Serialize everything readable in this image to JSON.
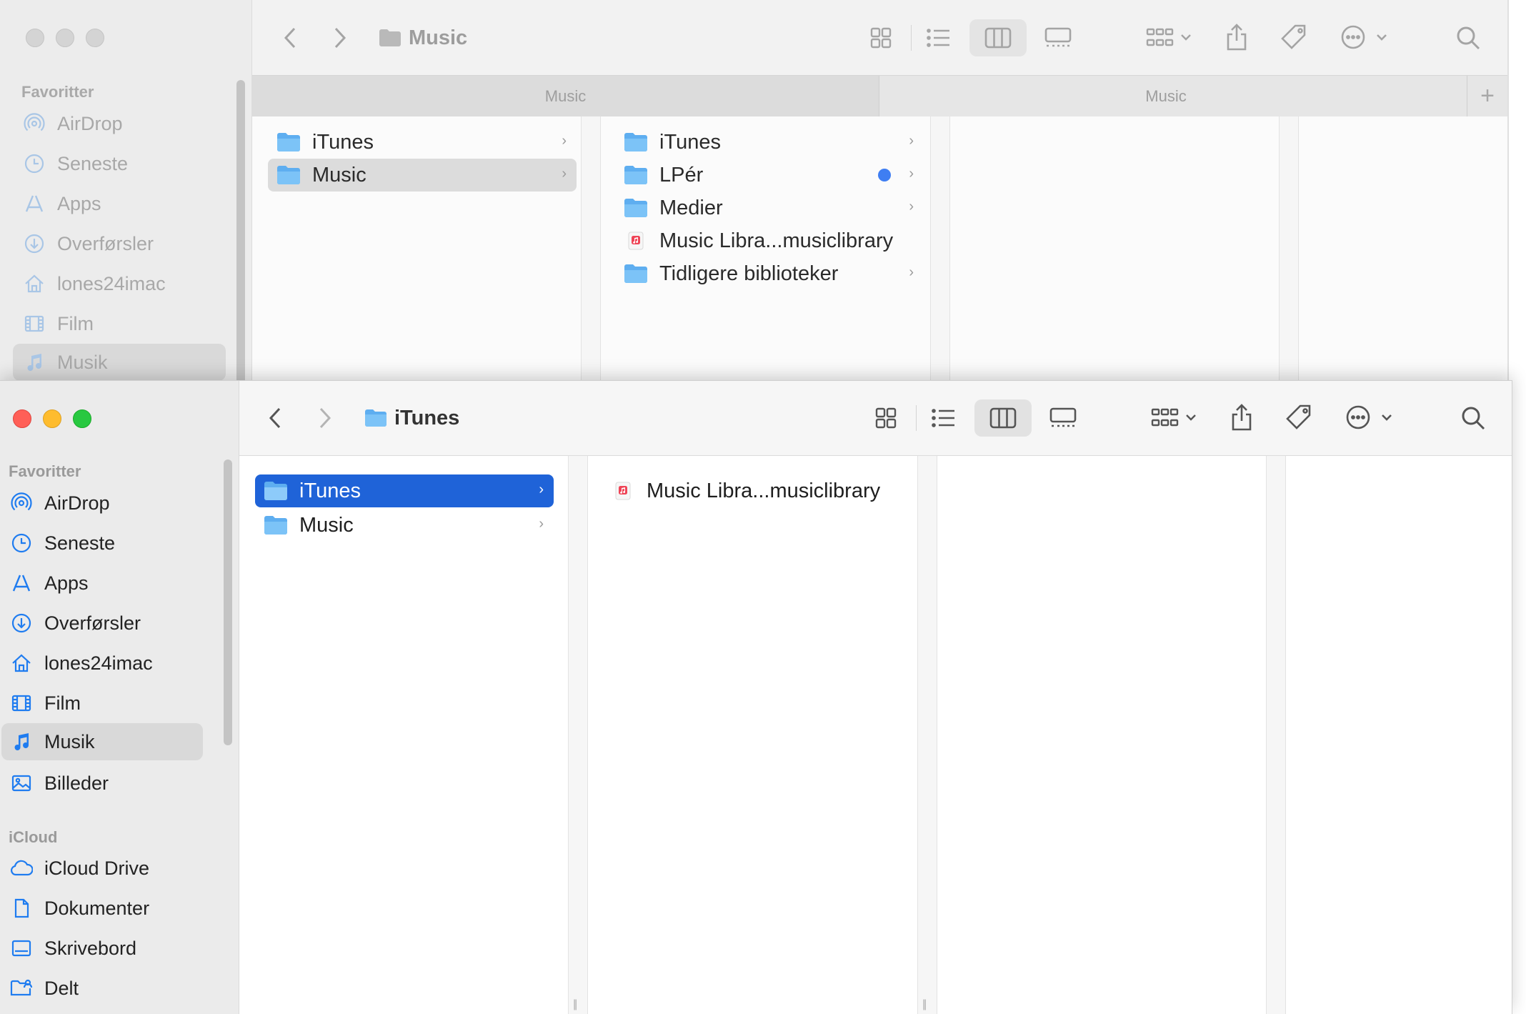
{
  "back_window": {
    "title": "Music",
    "sidebar": {
      "section_favorites": "Favoritter",
      "items": [
        {
          "label": "AirDrop",
          "icon": "airdrop-icon"
        },
        {
          "label": "Seneste",
          "icon": "clock-icon"
        },
        {
          "label": "Apps",
          "icon": "apps-icon"
        },
        {
          "label": "Overførsler",
          "icon": "download-icon"
        },
        {
          "label": "lones24imac",
          "icon": "home-icon"
        },
        {
          "label": "Film",
          "icon": "film-icon"
        },
        {
          "label": "Musik",
          "icon": "music-note-icon",
          "selected": true
        }
      ]
    },
    "tabs": [
      {
        "label": "Music",
        "active": true
      },
      {
        "label": "Music",
        "active": false
      }
    ],
    "column1": [
      {
        "label": "iTunes",
        "type": "folder",
        "selected": false
      },
      {
        "label": "Music",
        "type": "folder",
        "selected": true
      }
    ],
    "column2": [
      {
        "label": "iTunes",
        "type": "folder"
      },
      {
        "label": "LPér",
        "type": "folder",
        "tag_color": "#3f7ef2"
      },
      {
        "label": "Medier",
        "type": "folder"
      },
      {
        "label": "Music Libra...musiclibrary",
        "type": "music-library"
      },
      {
        "label": "Tidligere biblioteker",
        "type": "folder"
      }
    ]
  },
  "front_window": {
    "title": "iTunes",
    "sidebar": {
      "section_favorites": "Favoritter",
      "items": [
        {
          "label": "AirDrop",
          "icon": "airdrop-icon"
        },
        {
          "label": "Seneste",
          "icon": "clock-icon"
        },
        {
          "label": "Apps",
          "icon": "apps-icon"
        },
        {
          "label": "Overførsler",
          "icon": "download-icon"
        },
        {
          "label": "lones24imac",
          "icon": "home-icon"
        },
        {
          "label": "Film",
          "icon": "film-icon"
        },
        {
          "label": "Musik",
          "icon": "music-note-icon",
          "selected": true
        },
        {
          "label": "Billeder",
          "icon": "photo-icon"
        }
      ],
      "section_icloud": "iCloud",
      "icloud_items": [
        {
          "label": "iCloud Drive",
          "icon": "cloud-icon"
        },
        {
          "label": "Dokumenter",
          "icon": "document-icon"
        },
        {
          "label": "Skrivebord",
          "icon": "desktop-icon"
        },
        {
          "label": "Delt",
          "icon": "shared-folder-icon"
        }
      ]
    },
    "column1": [
      {
        "label": "iTunes",
        "type": "folder",
        "selected": true
      },
      {
        "label": "Music",
        "type": "folder",
        "selected": false
      }
    ],
    "column2": [
      {
        "label": "Music Libra...musiclibrary",
        "type": "music-library"
      }
    ]
  },
  "colors": {
    "accent": "#1f63d8",
    "sidebar_icon": "#1f7cf0",
    "folder": "#6cb7f2",
    "tag_blue": "#3f7ef2"
  }
}
